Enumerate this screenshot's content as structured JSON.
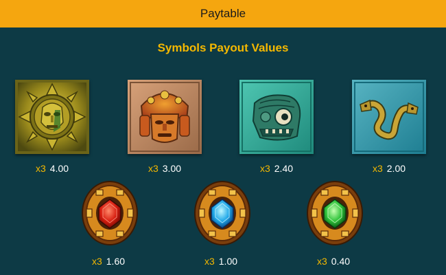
{
  "header": {
    "title": "Paytable"
  },
  "section": {
    "title": "Symbols Payout Values"
  },
  "symbols": [
    {
      "icon": "gold-sun-mask-icon",
      "multiplier": "x3",
      "value": "4.00"
    },
    {
      "icon": "orange-tribal-mask-icon",
      "multiplier": "x3",
      "value": "3.00"
    },
    {
      "icon": "jade-monster-head-icon",
      "multiplier": "x3",
      "value": "2.40"
    },
    {
      "icon": "serpent-tile-icon",
      "multiplier": "x3",
      "value": "2.00"
    },
    {
      "icon": "red-gem-medallion-icon",
      "multiplier": "x3",
      "value": "1.60"
    },
    {
      "icon": "blue-gem-medallion-icon",
      "multiplier": "x3",
      "value": "1.00"
    },
    {
      "icon": "green-gem-medallion-icon",
      "multiplier": "x3",
      "value": "0.40"
    }
  ],
  "colors": {
    "background": "#0d3a45",
    "header": "#f5a60f",
    "accent": "#f5b800",
    "value_text": "#ffffff"
  }
}
